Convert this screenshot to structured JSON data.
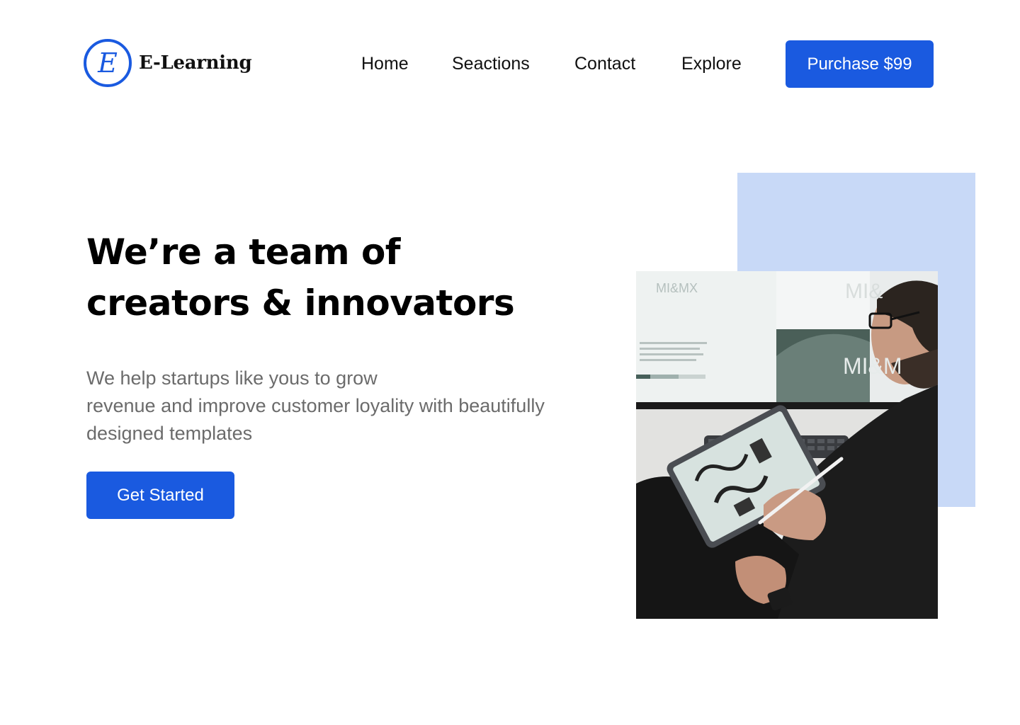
{
  "brand": {
    "logo_letter": "E",
    "name": "E-Learning"
  },
  "nav": {
    "items": [
      {
        "label": "Home"
      },
      {
        "label": "Seactions"
      },
      {
        "label": "Contact"
      },
      {
        "label": "Explore"
      }
    ],
    "purchase_label": "Purchase $99"
  },
  "hero": {
    "title_lines": [
      "We’re a team of",
      "creators & innovators"
    ],
    "description_lines": [
      "We help startups like yous to grow",
      "revenue and improve customer loyality with beautifully",
      "designed templates"
    ],
    "cta_label": "Get Started"
  },
  "photo": {
    "screen_text_left": "MI&MX",
    "screen_text_right_top": "MI&",
    "screen_text_right_bottom": "MI&M"
  },
  "colors": {
    "accent": "#1A5AE0",
    "accent_light": "#C8D9F7",
    "body_text": "#6B6B6B",
    "heading": "#000000"
  },
  "icons": {
    "logo": "letter-e-circle-icon"
  }
}
